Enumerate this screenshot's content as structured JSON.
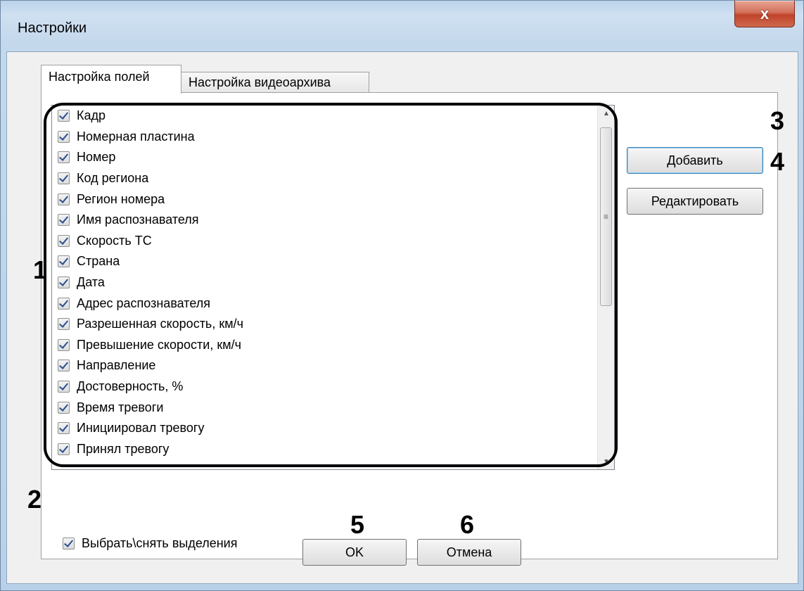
{
  "window": {
    "title": "Настройки",
    "close_glyph": "x"
  },
  "tabs": [
    {
      "label": "Настройка полей",
      "active": true
    },
    {
      "label": "Настройка видеоархива",
      "active": false
    }
  ],
  "fields": [
    {
      "label": "Кадр",
      "checked": true
    },
    {
      "label": "Номерная пластина",
      "checked": true
    },
    {
      "label": "Номер",
      "checked": true
    },
    {
      "label": "Код региона",
      "checked": true
    },
    {
      "label": "Регион номера",
      "checked": true
    },
    {
      "label": "Имя распознавателя",
      "checked": true
    },
    {
      "label": "Скорость ТС",
      "checked": true
    },
    {
      "label": "Страна",
      "checked": true
    },
    {
      "label": "Дата",
      "checked": true
    },
    {
      "label": "Адрес распознавателя",
      "checked": true
    },
    {
      "label": "Разрешенная скорость, км/ч",
      "checked": true
    },
    {
      "label": "Превышение скорости, км/ч",
      "checked": true
    },
    {
      "label": "Направление",
      "checked": true
    },
    {
      "label": "Достоверность, %",
      "checked": true
    },
    {
      "label": "Время тревоги",
      "checked": true
    },
    {
      "label": "Инициировал тревогу",
      "checked": true
    },
    {
      "label": "Принял тревогу",
      "checked": true
    }
  ],
  "buttons": {
    "add": "Добавить",
    "edit": "Редактировать",
    "ok": "OK",
    "cancel": "Отмена"
  },
  "select_all": {
    "label": "Выбрать\\снять  выделения",
    "checked": true
  },
  "callouts": {
    "c1": "1",
    "c2": "2",
    "c3": "3",
    "c4": "4",
    "c5": "5",
    "c6": "6"
  },
  "colors": {
    "title_bar": "#c4d8ec",
    "close_button": "#c0432a",
    "focus_border": "#3c7fb1"
  }
}
